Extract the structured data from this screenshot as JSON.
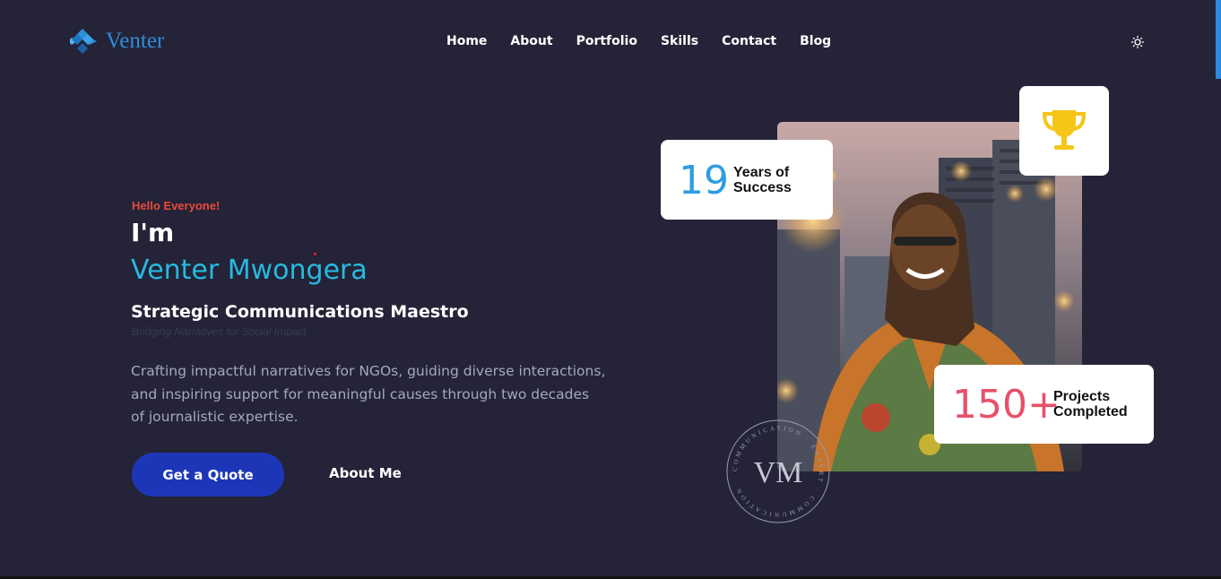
{
  "header": {
    "logo_text": "Venter",
    "nav": [
      "Home",
      "About",
      "Portfolio",
      "Skills",
      "Contact",
      "Blog"
    ],
    "theme_toggle_icon": "sun-icon"
  },
  "hero": {
    "greeting": "Hello Everyone!",
    "intro": "I'm",
    "name": "Venter Mwongera",
    "role": "Strategic Communications Maestro",
    "tagline": "Bridging Narratives for Social Impact",
    "description": "Crafting impactful narratives for NGOs, guiding diverse interactions, and inspiring support for meaningful causes through two decades of journalistic expertise.",
    "primary_button": "Get a Quote",
    "secondary_button": "About Me"
  },
  "stats": {
    "years_value": "19",
    "years_label_1": "Years of",
    "years_label_2": "Success",
    "trophy_icon": "trophy-icon",
    "projects_value": "150+",
    "projects_label_1": "Projects",
    "projects_label_2": "Completed"
  },
  "seal": {
    "monogram": "VM",
    "ring_text": "COMMUNICATION · EXPERT · COMMUNICATION"
  },
  "colors": {
    "background": "#242337",
    "accent_blue": "#27b9e0",
    "greeting_red": "#e9483c",
    "button_blue": "#1d36b8",
    "years_blue": "#2d9de0",
    "projects_red": "#e7516a",
    "trophy_gold": "#f5c518"
  }
}
